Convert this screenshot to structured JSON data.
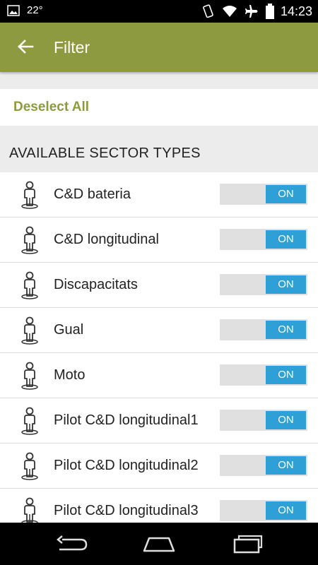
{
  "status_bar": {
    "temperature": "22°",
    "time": "14:23"
  },
  "app_bar": {
    "title": "Filter"
  },
  "actions": {
    "deselect_all": "Deselect All"
  },
  "section": {
    "title": "AVAILABLE SECTOR TYPES"
  },
  "sectors": [
    {
      "label": "C&D bateria",
      "toggle": "ON"
    },
    {
      "label": "C&D longitudinal",
      "toggle": "ON"
    },
    {
      "label": "Discapacitats",
      "toggle": "ON"
    },
    {
      "label": "Gual",
      "toggle": "ON"
    },
    {
      "label": "Moto",
      "toggle": "ON"
    },
    {
      "label": "Pilot C&D longitudinal1",
      "toggle": "ON"
    },
    {
      "label": "Pilot C&D longitudinal2",
      "toggle": "ON"
    },
    {
      "label": "Pilot C&D longitudinal3",
      "toggle": "ON"
    }
  ],
  "colors": {
    "accent": "#8e9a3f",
    "toggle_on": "#2ea0d6"
  },
  "icons": {
    "status": [
      "image-icon",
      "vibrate-icon",
      "wifi-icon",
      "airplane-icon",
      "battery-icon"
    ],
    "sector": "parking-person-icon",
    "nav": [
      "back-nav-icon",
      "home-nav-icon",
      "recents-nav-icon"
    ]
  }
}
